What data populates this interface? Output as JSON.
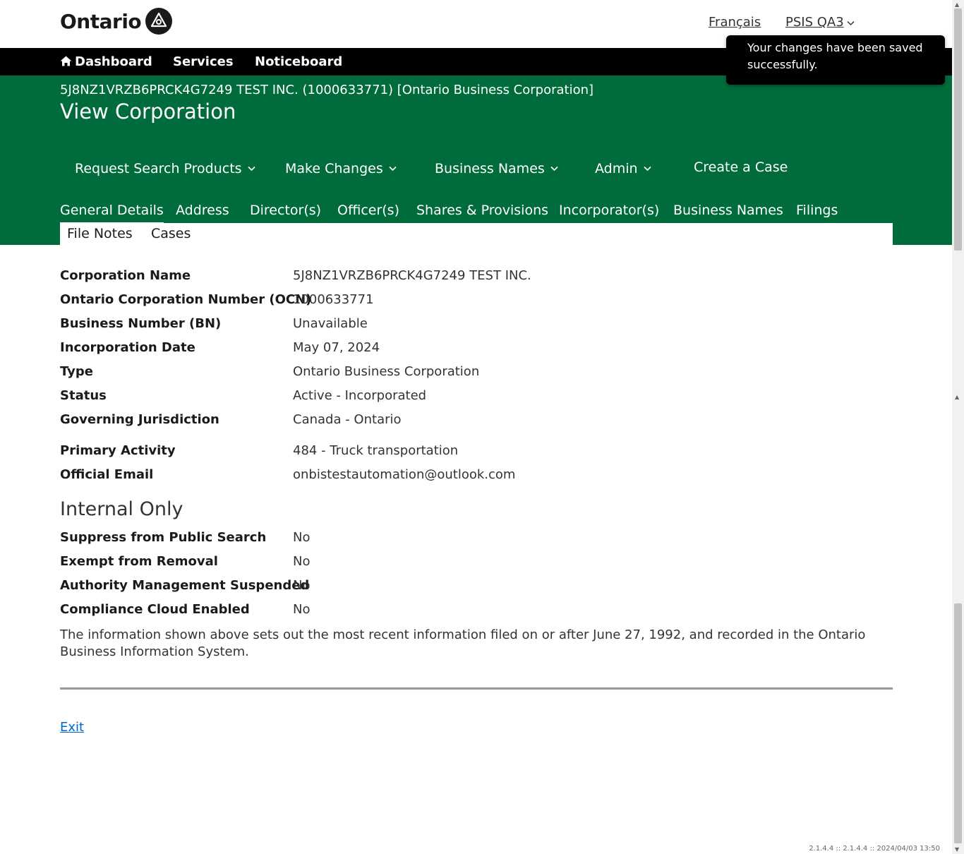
{
  "header": {
    "logo_text": "Ontario",
    "language_link": "Français",
    "user_menu_label": "PSIS QA3"
  },
  "nav": {
    "dashboard": "Dashboard",
    "services": "Services",
    "noticeboard": "Noticeboard"
  },
  "toast": {
    "message": "Your changes have been saved successfully."
  },
  "banner": {
    "breadcrumb": "5J8NZ1VRZB6PRCK4G7249 TEST INC. (1000633771) [Ontario Business Corporation]",
    "title": "View Corporation"
  },
  "actions": {
    "request_search": "Request Search Products",
    "make_changes": "Make Changes",
    "business_names": "Business Names",
    "admin": "Admin",
    "create_case": "Create a Case"
  },
  "tabs": {
    "general": "General Details",
    "address": "Address",
    "directors": "Director(s)",
    "officers": "Officer(s)",
    "shares": "Shares & Provisions",
    "incorporators": "Incorporator(s)",
    "business_names": "Business Names",
    "filings": "Filings",
    "file_notes": "File Notes",
    "cases": "Cases"
  },
  "details": [
    {
      "label": "Corporation Name",
      "value": "5J8NZ1VRZB6PRCK4G7249 TEST INC."
    },
    {
      "label": "Ontario Corporation Number (OCN)",
      "value": "1000633771"
    },
    {
      "label": "Business Number (BN)",
      "value": "Unavailable"
    },
    {
      "label": "Incorporation Date",
      "value": "May 07, 2024"
    },
    {
      "label": "Type",
      "value": "Ontario Business Corporation"
    },
    {
      "label": "Status",
      "value": "Active - Incorporated"
    },
    {
      "label": "Governing Jurisdiction",
      "value": "Canada - Ontario"
    },
    {
      "label": "Primary Activity",
      "value": "484 - Truck transportation"
    },
    {
      "label": "Official Email",
      "value": "onbistestautomation@outlook.com"
    }
  ],
  "internal": {
    "heading": "Internal Only",
    "rows": [
      {
        "label": "Suppress from Public Search",
        "value": "No"
      },
      {
        "label": "Exempt from Removal",
        "value": "No"
      },
      {
        "label": "Authority Management Suspended",
        "value": "No"
      },
      {
        "label": "Compliance Cloud Enabled",
        "value": "No"
      }
    ]
  },
  "disclaimer": "The information shown above sets out the most recent information filed on or after June 27, 1992, and recorded in the Ontario Business Information System.",
  "exit_link": "Exit",
  "version": "2.1.4.4 :: 2.1.4.4 :: 2024/04/03 13:50",
  "colors": {
    "brand_green": "#006c3c",
    "nav_black": "#000000",
    "link_blue": "#0066cc"
  },
  "icons": {
    "home": "home-icon",
    "chevron": "chevron-down-icon",
    "logo": "trillium-logo-icon"
  }
}
